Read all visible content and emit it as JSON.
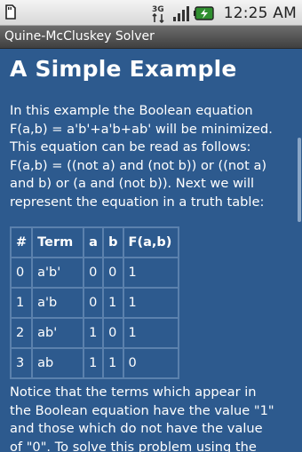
{
  "status_bar": {
    "time": "12:25 AM",
    "icons": [
      "sd-card-icon",
      "3g-icon",
      "signal-icon",
      "battery-icon"
    ]
  },
  "app": {
    "title": "Quine-McCluskey Solver"
  },
  "content": {
    "heading": "A Simple Example",
    "para1_lines": [
      "In this example the Boolean equation",
      "F(a,b) = a'b'+a'b+ab' will be minimized.",
      "This equation can be read as follows:",
      "F(a,b) = ((not a) and (not b)) or ((not a)",
      "and b) or (a and (not b)). Next we will",
      "represent the equation in a truth table:"
    ],
    "table": {
      "headers": [
        "#",
        "Term",
        "a",
        "b",
        "F(a,b)"
      ],
      "rows": [
        [
          "0",
          "a'b'",
          "0",
          "0",
          "1"
        ],
        [
          "1",
          "a'b",
          "0",
          "1",
          "1"
        ],
        [
          "2",
          "ab'",
          "1",
          "0",
          "1"
        ],
        [
          "3",
          "ab",
          "1",
          "1",
          "0"
        ]
      ]
    },
    "para2_lines": [
      "Notice that the terms which appear in",
      "the Boolean equation have the value \"1\"",
      "and those which do not have the value",
      "of \"0\". To solve this problem using the"
    ]
  },
  "colors": {
    "background": "#2d5a8e",
    "table_border": "#5b81ad",
    "title_bar": "#4f4f4f",
    "text": "#ffffff"
  }
}
